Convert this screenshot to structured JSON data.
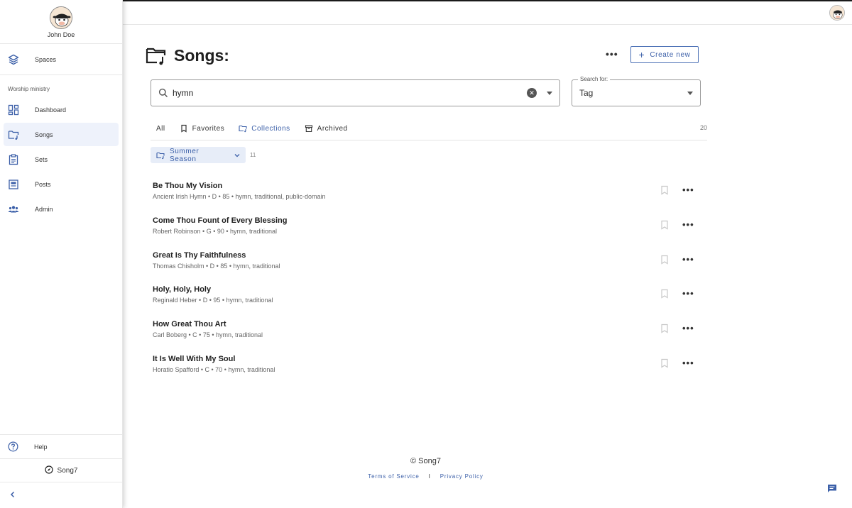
{
  "profile": {
    "name": "John Doe"
  },
  "sidebar": {
    "spaces_label": "Spaces",
    "section": "Worship ministry",
    "items": [
      {
        "label": "Dashboard",
        "icon": "dashboard-icon"
      },
      {
        "label": "Songs",
        "icon": "songs-folder-icon",
        "active": true
      },
      {
        "label": "Sets",
        "icon": "clipboard-icon"
      },
      {
        "label": "Posts",
        "icon": "posts-icon"
      },
      {
        "label": "Admin",
        "icon": "people-icon"
      }
    ],
    "help_label": "Help",
    "brand": "Song7"
  },
  "header": {
    "title": "Songs:",
    "create_label": "Create new"
  },
  "search": {
    "value": "hymn",
    "search_for_label": "Search for:",
    "search_for_value": "Tag"
  },
  "tabs": {
    "all": "All",
    "favorites": "Favorites",
    "collections": "Collections",
    "archived": "Archived",
    "count": "20",
    "active": "collections"
  },
  "collection": {
    "name": "Summer Season",
    "count": "11"
  },
  "songs": [
    {
      "title": "Be Thou My Vision",
      "meta": "Ancient Irish Hymn • D • 85 • hymn, traditional, public-domain"
    },
    {
      "title": "Come Thou Fount of Every Blessing",
      "meta": "Robert Robinson • G • 90 • hymn, traditional"
    },
    {
      "title": "Great Is Thy Faithfulness",
      "meta": "Thomas Chisholm • D • 85 • hymn, traditional"
    },
    {
      "title": "Holy, Holy, Holy",
      "meta": "Reginald Heber • D • 95 • hymn, traditional"
    },
    {
      "title": "How Great Thou Art",
      "meta": "Carl Boberg • C • 75 • hymn, traditional"
    },
    {
      "title": "It Is Well With My Soul",
      "meta": "Horatio Spafford • C • 70 • hymn, traditional"
    }
  ],
  "footer": {
    "copyright": "© Song7",
    "terms": "Terms of Service",
    "separator": "I",
    "privacy": "Privacy Policy"
  },
  "colors": {
    "accent": "#3b5fa8",
    "active_bg": "#eef2fb",
    "chip_bg": "#e7edf8"
  }
}
